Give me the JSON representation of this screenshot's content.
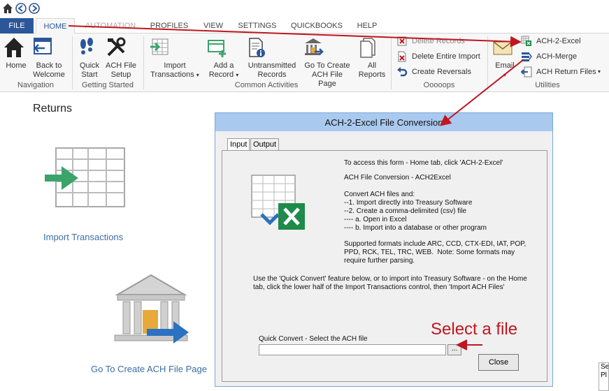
{
  "quick_access": {
    "icons": [
      "home-icon",
      "back-icon",
      "forward-icon"
    ]
  },
  "tabs": [
    "FILE",
    "HOME",
    "AUTOMATION",
    "PROFILES",
    "VIEW",
    "SETTINGS",
    "QUICKBOOKS",
    "HELP"
  ],
  "ribbon": {
    "navigation": {
      "group": "Navigation",
      "home": "Home",
      "back_to_welcome": [
        "Back to",
        "Welcome"
      ]
    },
    "getting_started": {
      "group": "Getting Started",
      "quick_start": [
        "Quick",
        "Start"
      ],
      "ach_file_setup": [
        "ACH File",
        "Setup"
      ]
    },
    "common_activities": {
      "group": "Common Activities",
      "import_transactions": [
        "Import",
        "Transactions"
      ],
      "add_record": [
        "Add a",
        "Record"
      ],
      "untransmitted": [
        "Untransmitted",
        "Records"
      ],
      "go_to_ach": [
        "Go To Create",
        "ACH File Page"
      ],
      "all_reports": [
        "All",
        "Reports"
      ]
    },
    "oooops": {
      "group": "Ooooops",
      "delete_records": "Delete Records",
      "delete_entire_import": "Delete Entire Import",
      "create_reversals": "Create Reversals"
    },
    "utilities": {
      "group": "Utilities",
      "email": "Email",
      "ach2excel": "ACH-2-Excel",
      "ach_merge": "ACH-Merge",
      "ach_return_files": "ACH Return Files"
    }
  },
  "main": {
    "title": "Returns",
    "import_transactions_link": "Import Transactions",
    "go_to_create_ach_link": "Go To Create ACH File Page"
  },
  "dialog": {
    "title": "ACH-2-Excel File Conversion",
    "tabs": [
      "Input",
      "Output"
    ],
    "lines": [
      "To access this form - Home tab, click 'ACH-2-Excel'",
      "ACH File Conversion - ACH2Excel",
      "Convert ACH files and:",
      "--1. Import directly into Treasury Software",
      "--2. Create a comma-delimited (csv) file",
      "---- a. Open in Excel",
      "---- b. Import into a database or other program",
      "Supported formats include ARC, CCD, CTX-EDI, IAT, POP,",
      "PPD, RCK, TEL, TRC, WEB.  Note: Some formats may",
      "require further parsing."
    ],
    "footer_lines": [
      "Use the 'Quick Convert' feature below, or to import into Treasury Software - on the Home",
      "tab, click the lower half of the Import Transactions control, then 'Import ACH Files'"
    ],
    "quick_convert_label": "Quick Convert - Select the ACH file",
    "browse_label": "...",
    "close_label": "Close"
  },
  "annotation": {
    "text": "Select a file",
    "color": "#c0161e"
  },
  "corner_fragment": [
    "Se",
    "Pl"
  ],
  "colors": {
    "file_tab": "#2b579a",
    "dialog_title_bg": "#a9c9ee",
    "link": "#3b6ea5",
    "excel_green": "#1e8b4b"
  }
}
